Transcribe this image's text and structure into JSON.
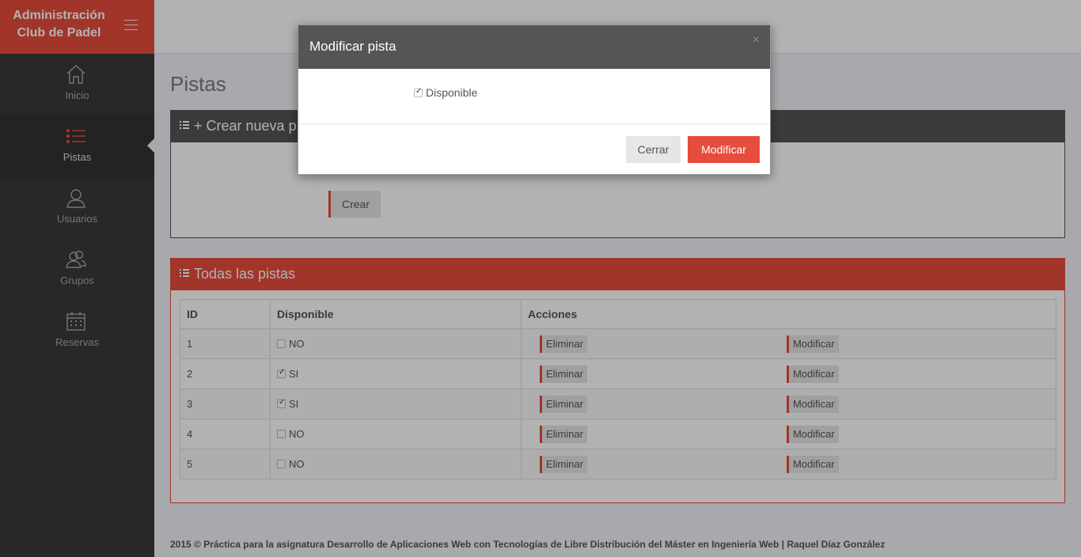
{
  "brand": {
    "line1": "Administración",
    "line2": "Club de Padel"
  },
  "sidebar": {
    "items": [
      {
        "label": "Inicio",
        "icon": "home-icon"
      },
      {
        "label": "Pistas",
        "icon": "list-icon",
        "active": true
      },
      {
        "label": "Usuarios",
        "icon": "user-icon"
      },
      {
        "label": "Grupos",
        "icon": "group-icon"
      },
      {
        "label": "Reservas",
        "icon": "calendar-icon"
      }
    ]
  },
  "page": {
    "title": "Pistas"
  },
  "create_panel": {
    "title": "+ Crear nueva p",
    "button": "Crear"
  },
  "all_panel": {
    "title": "Todas las pistas",
    "columns": [
      "ID",
      "Disponible",
      "Acciones"
    ],
    "rows": [
      {
        "id": "1",
        "available": "NO",
        "checked": false,
        "delete": "Eliminar",
        "edit": "Modificar"
      },
      {
        "id": "2",
        "available": "SI",
        "checked": true,
        "delete": "Eliminar",
        "edit": "Modificar"
      },
      {
        "id": "3",
        "available": "SI",
        "checked": true,
        "delete": "Eliminar",
        "edit": "Modificar"
      },
      {
        "id": "4",
        "available": "NO",
        "checked": false,
        "delete": "Eliminar",
        "edit": "Modificar"
      },
      {
        "id": "5",
        "available": "NO",
        "checked": false,
        "delete": "Eliminar",
        "edit": "Modificar"
      }
    ]
  },
  "footer": {
    "text": "2015 © Práctica para la asignatura Desarrollo de Aplicaciones Web con Tecnologías de Libre Distribución del Máster en Ingeniería Web | Raquel Díaz González"
  },
  "modal": {
    "title": "Modificar pista",
    "close": "×",
    "checkbox_label": "Disponible",
    "checkbox_checked": true,
    "cancel": "Cerrar",
    "submit": "Modificar"
  },
  "colors": {
    "accent": "#e74c3c",
    "sidebar": "#3a3a3a",
    "panel_head": "#555555"
  }
}
